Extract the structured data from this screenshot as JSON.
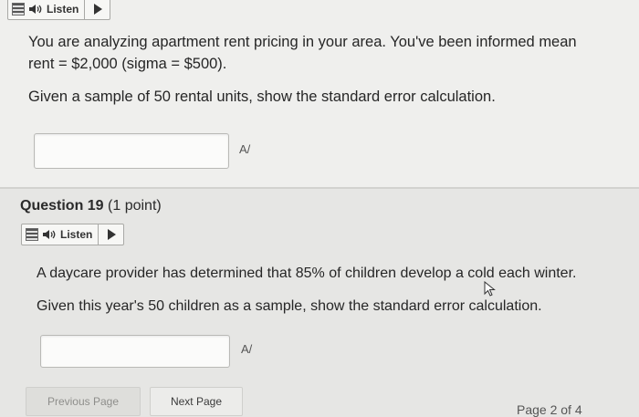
{
  "q18": {
    "listen_label": "Listen",
    "text_line1": "You are analyzing apartment rent pricing in your area. You've been informed mean",
    "text_line2": "rent = $2,000 (sigma = $500).",
    "text_line3": "Given a sample of 50 rental units, show the standard error calculation.",
    "answer_value": "",
    "spell_icon": "A/"
  },
  "q19": {
    "title_number": "Question 19",
    "title_points": "(1 point)",
    "listen_label": "Listen",
    "text_line1": "A daycare provider has determined that 85% of children develop a cold each winter.",
    "text_line2": "Given this year's 50 children as a sample, show the standard error calculation.",
    "answer_value": "",
    "spell_icon": "A/"
  },
  "nav": {
    "previous_label": "Previous Page",
    "next_label": "Next Page",
    "page_indicator": "Page 2 of 4"
  }
}
